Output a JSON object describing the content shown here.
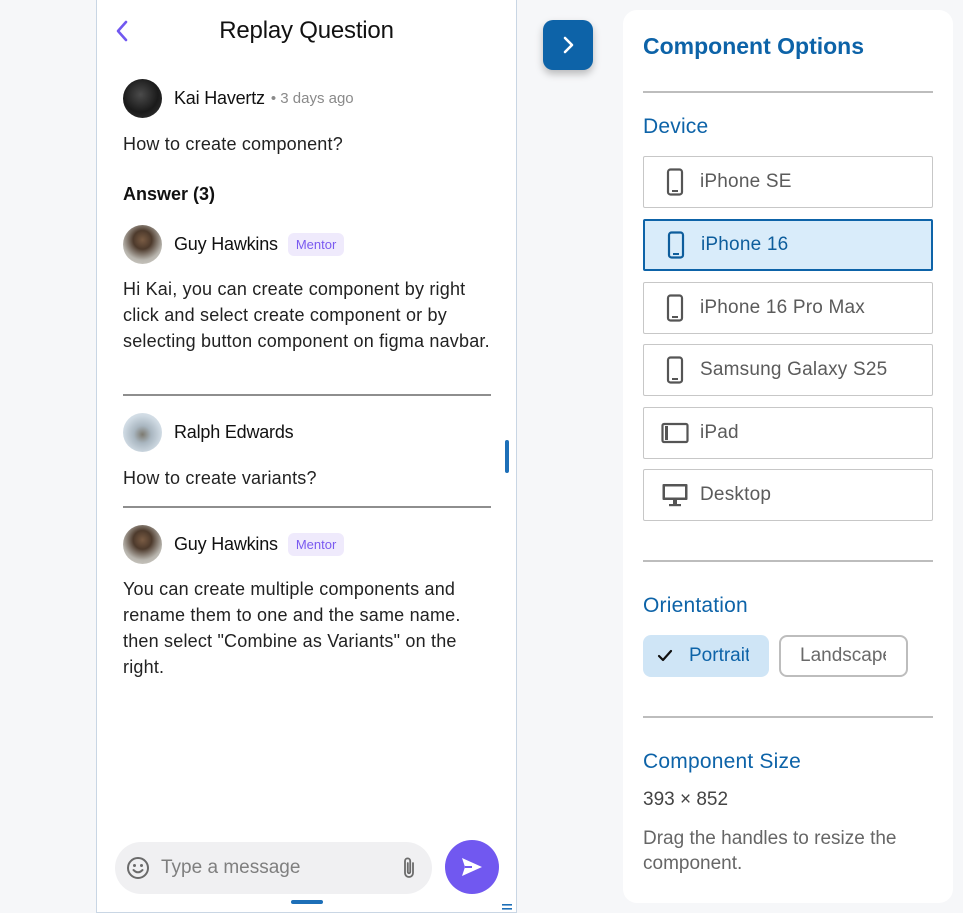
{
  "phone": {
    "title": "Replay Question",
    "question": {
      "author": "Kai Havertz",
      "time": "• 3 days ago",
      "text": "How to create component?"
    },
    "answers_label": "Answer (3)",
    "messages": [
      {
        "author": "Guy Hawkins",
        "badge": "Mentor",
        "text": "Hi Kai, you can create component by right click and select create component or by selecting button component on figma navbar."
      },
      {
        "author": "Ralph Edwards",
        "text": "How to create variants?"
      },
      {
        "author": "Guy Hawkins",
        "badge": "Mentor",
        "text": "You can create multiple components and rename them to one and the same name. then select \"Combine as Variants\" on the right."
      }
    ],
    "composer": {
      "placeholder": "Type a message"
    }
  },
  "panel": {
    "title": "Component Options",
    "device_heading": "Device",
    "devices": [
      {
        "label": "iPhone SE",
        "icon": "phone-icon"
      },
      {
        "label": "iPhone 16",
        "icon": "phone-icon",
        "selected": true
      },
      {
        "label": "iPhone 16 Pro Max",
        "icon": "phone-icon"
      },
      {
        "label": "Samsung Galaxy S25",
        "icon": "phone-icon"
      },
      {
        "label": "iPad",
        "icon": "tablet-icon"
      },
      {
        "label": "Desktop",
        "icon": "desktop-icon"
      }
    ],
    "orientation_heading": "Orientation",
    "orientation": {
      "portrait": "Portrait",
      "landscape": "Landscape",
      "selected": "Portrait"
    },
    "size_heading": "Component Size",
    "size_value": "393 × 852",
    "size_hint": "Drag the handles to resize the component."
  },
  "colors": {
    "accent": "#0d63a8",
    "send": "#7158f0",
    "mentor_badge_bg": "#efeafc",
    "mentor_badge_text": "#7a5af0",
    "selected_bg": "#d9ecfa"
  }
}
